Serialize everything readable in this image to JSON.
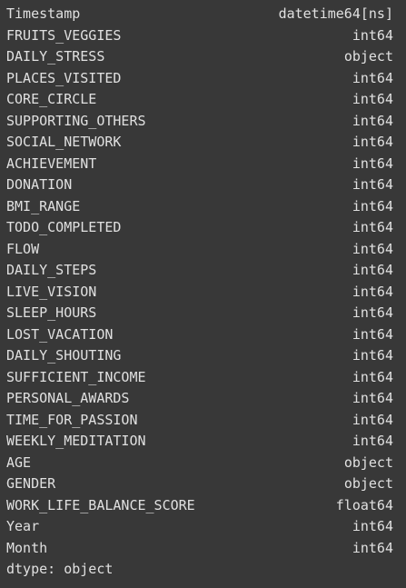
{
  "output": {
    "rows": [
      {
        "name": "Timestamp",
        "dtype": "datetime64[ns]"
      },
      {
        "name": "FRUITS_VEGGIES",
        "dtype": "int64"
      },
      {
        "name": "DAILY_STRESS",
        "dtype": "object"
      },
      {
        "name": "PLACES_VISITED",
        "dtype": "int64"
      },
      {
        "name": "CORE_CIRCLE",
        "dtype": "int64"
      },
      {
        "name": "SUPPORTING_OTHERS",
        "dtype": "int64"
      },
      {
        "name": "SOCIAL_NETWORK",
        "dtype": "int64"
      },
      {
        "name": "ACHIEVEMENT",
        "dtype": "int64"
      },
      {
        "name": "DONATION",
        "dtype": "int64"
      },
      {
        "name": "BMI_RANGE",
        "dtype": "int64"
      },
      {
        "name": "TODO_COMPLETED",
        "dtype": "int64"
      },
      {
        "name": "FLOW",
        "dtype": "int64"
      },
      {
        "name": "DAILY_STEPS",
        "dtype": "int64"
      },
      {
        "name": "LIVE_VISION",
        "dtype": "int64"
      },
      {
        "name": "SLEEP_HOURS",
        "dtype": "int64"
      },
      {
        "name": "LOST_VACATION",
        "dtype": "int64"
      },
      {
        "name": "DAILY_SHOUTING",
        "dtype": "int64"
      },
      {
        "name": "SUFFICIENT_INCOME",
        "dtype": "int64"
      },
      {
        "name": "PERSONAL_AWARDS",
        "dtype": "int64"
      },
      {
        "name": "TIME_FOR_PASSION",
        "dtype": "int64"
      },
      {
        "name": "WEEKLY_MEDITATION",
        "dtype": "int64"
      },
      {
        "name": "AGE",
        "dtype": "object"
      },
      {
        "name": "GENDER",
        "dtype": "object"
      },
      {
        "name": "WORK_LIFE_BALANCE_SCORE",
        "dtype": "float64"
      },
      {
        "name": "Year",
        "dtype": "int64"
      },
      {
        "name": "Month",
        "dtype": "int64"
      }
    ],
    "footer": "dtype: object"
  },
  "colors": {
    "background": "#383838",
    "text": "#e0e0e0"
  }
}
